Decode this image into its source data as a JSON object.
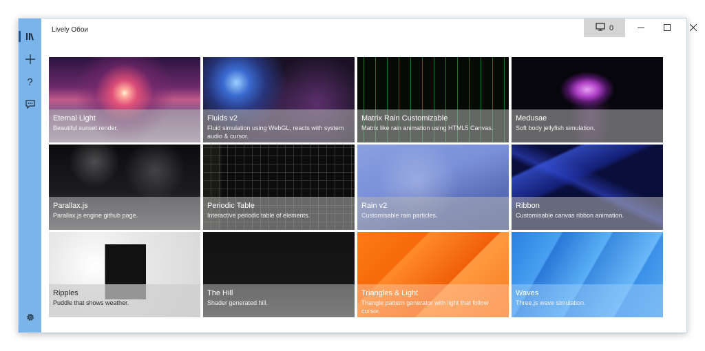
{
  "app": {
    "title": "Lively Обои"
  },
  "titlebar": {
    "screen_count": "0"
  },
  "colors": {
    "sidebar": "#7ab4e8",
    "caption_bg": "#b4b4b4",
    "screen_btn": "#d4d4d4"
  },
  "sidebar": {
    "items": [
      {
        "icon": "library-icon"
      },
      {
        "icon": "plus-icon"
      },
      {
        "icon": "help-icon"
      },
      {
        "icon": "feedback-icon"
      },
      {
        "icon": "gear-icon"
      }
    ]
  },
  "wallpapers": [
    {
      "title": "Eternal Light",
      "description": "Beautiful sunset render."
    },
    {
      "title": "Fluids v2",
      "description": "Fluid simulation using WebGL, reacts with system audio & cursor."
    },
    {
      "title": "Matrix Rain Customizable",
      "description": "Matrix like rain animation using HTML5 Canvas."
    },
    {
      "title": "Medusae",
      "description": "Soft body jellyfish simulation."
    },
    {
      "title": "Parallax.js",
      "description": "Parallax.js engine github page."
    },
    {
      "title": "Periodic Table",
      "description": "Interactive periodic table of elements."
    },
    {
      "title": "Rain v2",
      "description": "Customisable rain particles."
    },
    {
      "title": "Ribbon",
      "description": "Customisable canvas ribbon animation."
    },
    {
      "title": "Ripples",
      "description": "Puddle that shows weather."
    },
    {
      "title": "The Hill",
      "description": "Shader generated hill."
    },
    {
      "title": "Triangles & Light",
      "description": "Triangle pattern generator with light that follow cursor."
    },
    {
      "title": "Waves",
      "description": "Three.js wave simulation."
    }
  ]
}
